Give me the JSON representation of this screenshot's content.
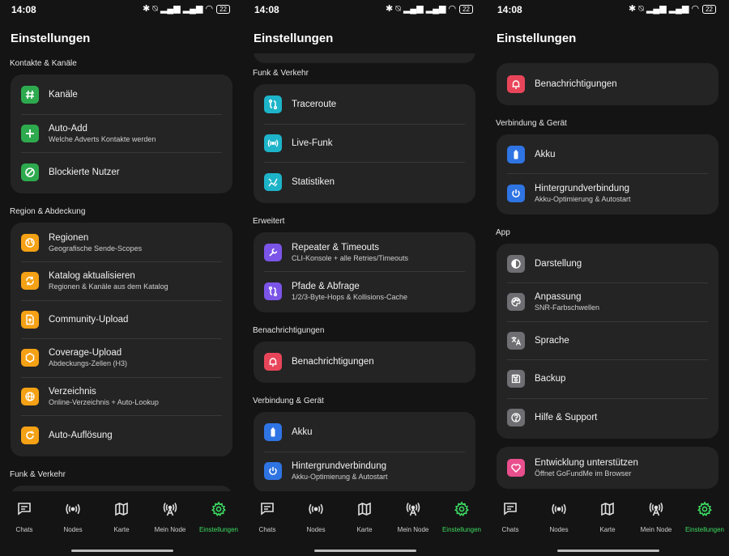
{
  "status": {
    "time": "14:08",
    "battery": "22"
  },
  "title": "Einstellungen",
  "colors": {
    "accent": "#3ddc62",
    "background": "#141414",
    "card": "#242424",
    "green": "#2eaa4e",
    "orange": "#f5a115",
    "teal": "#1db4c9",
    "purple": "#7b54e8",
    "red": "#e9455a",
    "blue": "#2f74e3",
    "gray": "#6e6e73",
    "pink": "#e94f8d"
  },
  "sections": {
    "kontakte": {
      "title": "Kontakte & Kanäle",
      "items": [
        {
          "label": "Kanäle",
          "icon": "hash-icon"
        },
        {
          "label": "Auto-Add",
          "sub": "Welche Adverts Kontakte werden",
          "icon": "plus-icon"
        },
        {
          "label": "Blockierte Nutzer",
          "icon": "block-icon"
        }
      ]
    },
    "region": {
      "title": "Region & Abdeckung",
      "items": [
        {
          "label": "Regionen",
          "sub": "Geografische Sende-Scopes",
          "icon": "globe-icon"
        },
        {
          "label": "Katalog aktualisieren",
          "sub": "Regionen & Kanäle aus dem Katalog",
          "icon": "sync-icon"
        },
        {
          "label": "Community-Upload",
          "icon": "upload-file-icon"
        },
        {
          "label": "Coverage-Upload",
          "sub": "Abdeckungs-Zellen (H3)",
          "icon": "hexagon-icon"
        },
        {
          "label": "Verzeichnis",
          "sub": "Online-Verzeichnis + Auto-Lookup",
          "icon": "globe-icon"
        },
        {
          "label": "Auto-Auflösung",
          "icon": "refresh-icon"
        }
      ]
    },
    "funk": {
      "title": "Funk & Verkehr",
      "items": [
        {
          "label": "Traceroute",
          "icon": "route-icon"
        },
        {
          "label": "Live-Funk",
          "icon": "radio-waves-icon"
        },
        {
          "label": "Statistiken",
          "icon": "stats-icon"
        }
      ]
    },
    "erweitert": {
      "title": "Erweitert",
      "items": [
        {
          "label": "Repeater & Timeouts",
          "sub": "CLI-Konsole + alle Retries/Timeouts",
          "icon": "wrench-icon"
        },
        {
          "label": "Pfade & Abfrage",
          "sub": "1/2/3-Byte-Hops & Kollisions-Cache",
          "icon": "path-icon"
        }
      ]
    },
    "benach": {
      "title": "Benachrichtigungen",
      "items": [
        {
          "label": "Benachrichtigungen",
          "icon": "bell-icon"
        }
      ]
    },
    "verbindung": {
      "title": "Verbindung & Gerät",
      "items": [
        {
          "label": "Akku",
          "icon": "battery-icon"
        },
        {
          "label": "Hintergrundverbindung",
          "sub": "Akku-Optimierung & Autostart",
          "icon": "power-icon"
        }
      ]
    },
    "app": {
      "title": "App",
      "items": [
        {
          "label": "Darstellung",
          "icon": "contrast-icon"
        },
        {
          "label": "Anpassung",
          "sub": "SNR-Farbschwellen",
          "icon": "palette-icon"
        },
        {
          "label": "Sprache",
          "icon": "translate-icon"
        },
        {
          "label": "Backup",
          "icon": "save-icon"
        },
        {
          "label": "Hilfe & Support",
          "icon": "help-icon"
        }
      ]
    },
    "support": {
      "items": [
        {
          "label": "Entwicklung unterstützen",
          "sub": "Öffnet GoFundMe im Browser",
          "icon": "heart-icon"
        }
      ]
    }
  },
  "nav": [
    {
      "label": "Chats",
      "icon": "chat-icon"
    },
    {
      "label": "Nodes",
      "icon": "radio-waves-icon"
    },
    {
      "label": "Karte",
      "icon": "map-icon"
    },
    {
      "label": "Mein Node",
      "icon": "antenna-icon"
    },
    {
      "label": "Einstellungen",
      "icon": "gear-icon",
      "active": true
    }
  ]
}
